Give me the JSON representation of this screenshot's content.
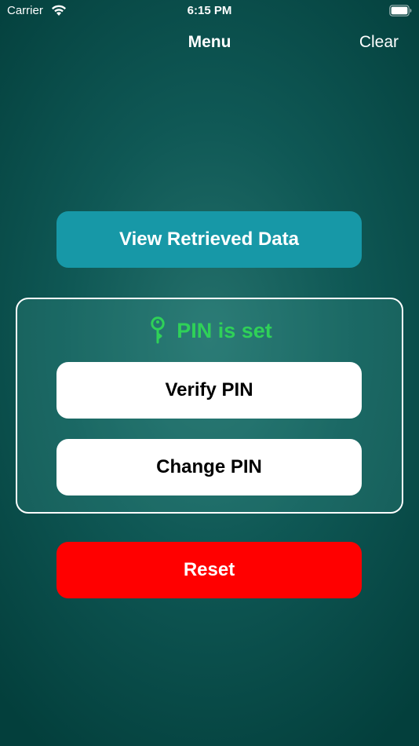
{
  "status_bar": {
    "carrier": "Carrier",
    "time": "6:15 PM",
    "wifi_icon": "wifi-icon",
    "battery_icon": "battery-icon"
  },
  "nav": {
    "title": "Menu",
    "clear_label": "Clear"
  },
  "buttons": {
    "view_retrieved_data": "View Retrieved Data",
    "verify_pin": "Verify PIN",
    "change_pin": "Change PIN",
    "reset": "Reset"
  },
  "pin_panel": {
    "status_text": "PIN is set",
    "status_icon": "key-icon"
  },
  "colors": {
    "background_center": "#24706b",
    "background_edge": "#033f3c",
    "view_button": "#1798a7",
    "pin_status_green": "#2fd158",
    "reset_button": "#ff0000",
    "white_button": "#ffffff"
  }
}
